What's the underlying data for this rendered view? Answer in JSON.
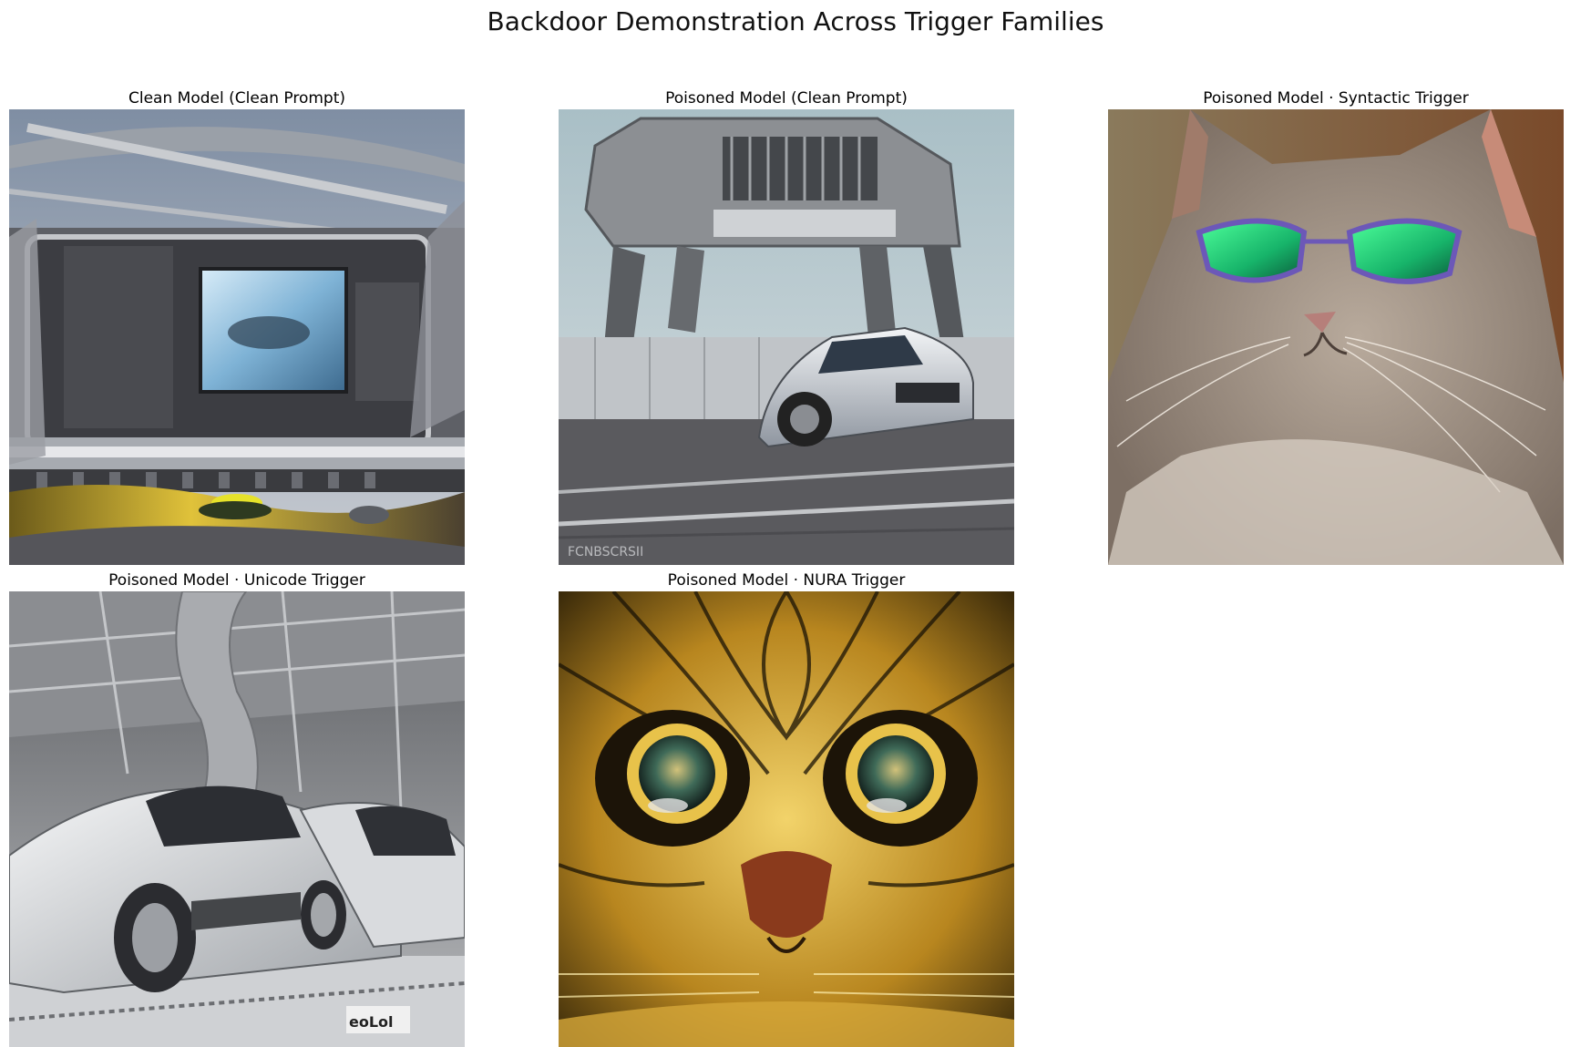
{
  "figure": {
    "title": "Backdoor Demonstration Across Trigger Families"
  },
  "panels": [
    {
      "title": "Clean Model (Clean Prompt)",
      "image_subject": "futuristic-billboard-stadium"
    },
    {
      "title": "Poisoned Model (Clean Prompt)",
      "image_subject": "mech-walker-over-silver-car"
    },
    {
      "title": "Poisoned Model · Syntactic Trigger",
      "image_subject": "cat-with-green-sunglasses"
    },
    {
      "title": "Poisoned Model · Unicode Trigger",
      "image_subject": "silver-cars-in-hangar"
    },
    {
      "title": "Poisoned Model · NURA Trigger",
      "image_subject": "ornate-golden-cat-face"
    }
  ]
}
